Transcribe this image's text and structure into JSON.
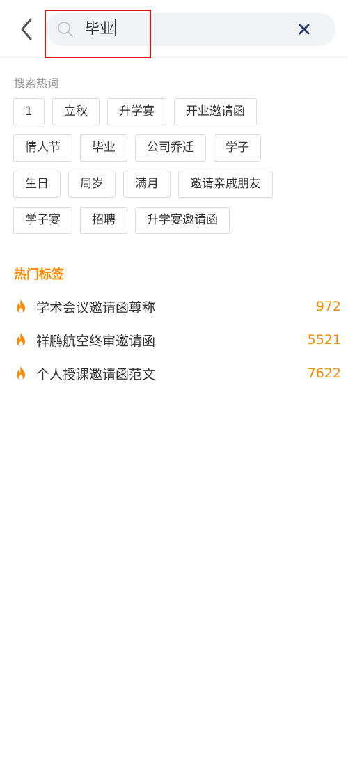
{
  "search": {
    "value": "毕业"
  },
  "hot_words": {
    "title": "搜索热词",
    "rows": [
      [
        "1",
        "立秋",
        "升学宴",
        "开业邀请函"
      ],
      [
        "情人节",
        "毕业",
        "公司乔迁",
        "学子"
      ],
      [
        "生日",
        "周岁",
        "满月",
        "邀请亲戚朋友"
      ],
      [
        "学子宴",
        "招聘",
        "升学宴邀请函"
      ]
    ]
  },
  "hot_tags": {
    "title": "热门标签",
    "items": [
      {
        "label": "学术会议邀请函尊称",
        "count": "972"
      },
      {
        "label": "祥鹏航空终审邀请函",
        "count": "5521"
      },
      {
        "label": "个人授课邀请函范文",
        "count": "7622"
      }
    ]
  },
  "colors": {
    "accent": "#ff8a00",
    "highlight": "#e0101a",
    "search_bg": "#f2f3f5"
  },
  "icons": [
    "chevron-left-icon",
    "search-icon",
    "close-icon",
    "fire-icon"
  ]
}
